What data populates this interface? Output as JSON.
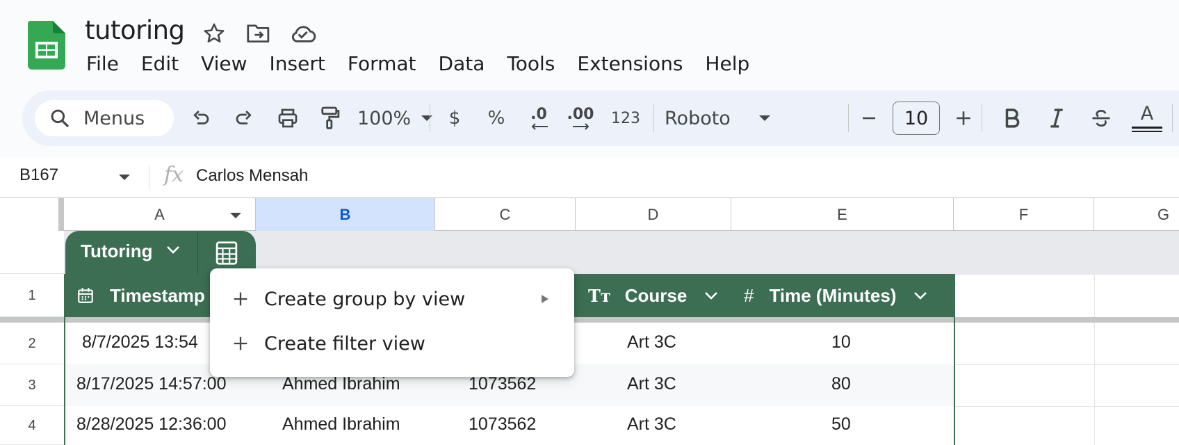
{
  "app": {
    "doc_title": "tutoring",
    "icons": [
      "sheets-logo-icon",
      "star-icon",
      "move-folder-icon",
      "cloud-saved-icon"
    ]
  },
  "menubar": {
    "items": [
      "File",
      "Edit",
      "View",
      "Insert",
      "Format",
      "Data",
      "Tools",
      "Extensions",
      "Help"
    ]
  },
  "toolbar": {
    "search_label": "Menus",
    "zoom": "100%",
    "currency": "$",
    "percent": "%",
    "decrease_decimal": ".0",
    "increase_decimal": ".00",
    "more_formats": "123",
    "font": "Roboto",
    "font_size": "10",
    "text_color_label": "A"
  },
  "formula_bar": {
    "name_box": "B167",
    "fx": "fx",
    "content": "Carlos Mensah"
  },
  "grid": {
    "columns": [
      "A",
      "B",
      "C",
      "D",
      "E",
      "F",
      "G"
    ],
    "selected_column": "B",
    "row_numbers": [
      "1",
      "2",
      "3",
      "4"
    ],
    "table_name": "Tutoring",
    "headers": {
      "timestamp": "Timestamp",
      "course": "Course",
      "course_type_icon": "Tт",
      "time": "Time (Minutes)",
      "time_type_icon": "#"
    },
    "rows": [
      {
        "timestamp": "8/7/2025 13:54",
        "name": "",
        "id": "",
        "course": "Art 3C",
        "time": "10"
      },
      {
        "timestamp": "8/17/2025 14:57:00",
        "name": "Ahmed Ibrahim",
        "id": "1073562",
        "course": "Art 3C",
        "time": "80"
      },
      {
        "timestamp": "8/28/2025 12:36:00",
        "name": "Ahmed Ibrahim",
        "id": "1073562",
        "course": "Art 3C",
        "time": "50"
      }
    ]
  },
  "dropdown": {
    "items": [
      {
        "label": "Create group by view",
        "has_submenu": true
      },
      {
        "label": "Create filter view",
        "has_submenu": false
      }
    ]
  },
  "colors": {
    "table_green": "#3b6e52",
    "selected_column": "#d3e3fd",
    "toolbar_bg": "#edf2fa",
    "sheets_green": "#34a853"
  }
}
